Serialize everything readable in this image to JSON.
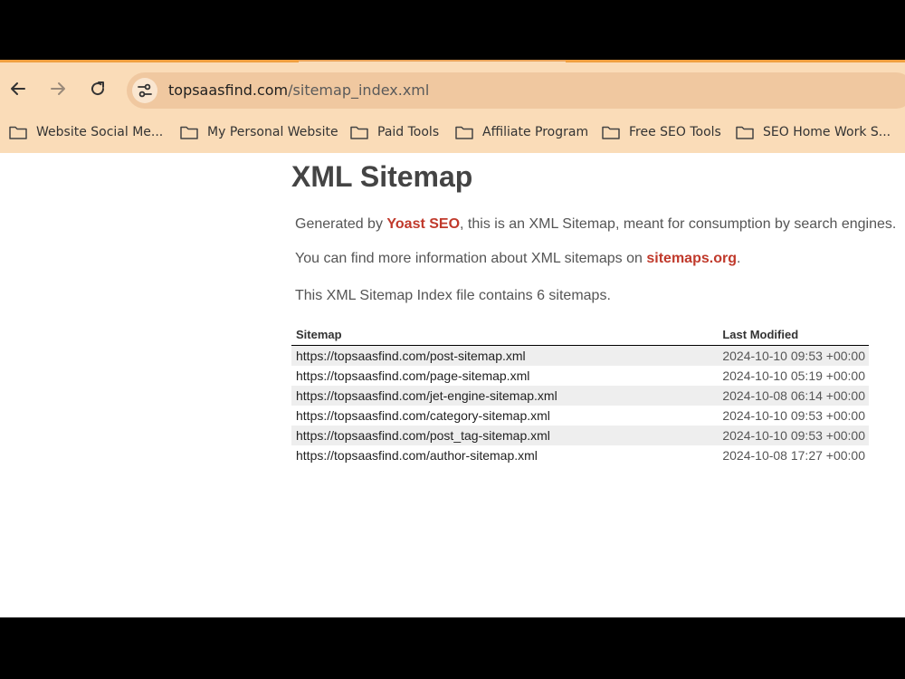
{
  "browser": {
    "url_host": "topsaasfind.com",
    "url_path": "/sitemap_index.xml",
    "bookmarks": [
      {
        "label": "Website Social Me..."
      },
      {
        "label": "My Personal Website"
      },
      {
        "label": "Paid Tools"
      },
      {
        "label": "Affiliate Program"
      },
      {
        "label": "Free SEO Tools"
      },
      {
        "label": "SEO Home Work S..."
      }
    ]
  },
  "page": {
    "title": "XML Sitemap",
    "generated_prefix": "Generated by ",
    "generated_link": "Yoast SEO",
    "generated_suffix": ", this is an XML Sitemap, meant for consumption by search engines.",
    "info_prefix": "You can find more information about XML sitemaps on ",
    "info_link": "sitemaps.org",
    "info_suffix": ".",
    "count_text": "This XML Sitemap Index file contains 6 sitemaps.",
    "table": {
      "headers": [
        "Sitemap",
        "Last Modified"
      ],
      "rows": [
        {
          "sitemap": "https://topsaasfind.com/post-sitemap.xml",
          "modified": "2024-10-10 09:53 +00:00"
        },
        {
          "sitemap": "https://topsaasfind.com/page-sitemap.xml",
          "modified": "2024-10-10 05:19 +00:00"
        },
        {
          "sitemap": "https://topsaasfind.com/jet-engine-sitemap.xml",
          "modified": "2024-10-08 06:14 +00:00"
        },
        {
          "sitemap": "https://topsaasfind.com/category-sitemap.xml",
          "modified": "2024-10-10 09:53 +00:00"
        },
        {
          "sitemap": "https://topsaasfind.com/post_tag-sitemap.xml",
          "modified": "2024-10-10 09:53 +00:00"
        },
        {
          "sitemap": "https://topsaasfind.com/author-sitemap.xml",
          "modified": "2024-10-08 17:27 +00:00"
        }
      ]
    }
  },
  "icons": {
    "back": "back-arrow-icon",
    "forward": "forward-arrow-icon",
    "reload": "reload-icon",
    "site_info": "site-settings-icon",
    "bookmark": "folder-icon"
  },
  "colors": {
    "toolbar_bg": "#fadcb8",
    "address_bg": "#f0c8a0",
    "link_accent": "#c0392b",
    "row_alt": "#eeeeee"
  }
}
